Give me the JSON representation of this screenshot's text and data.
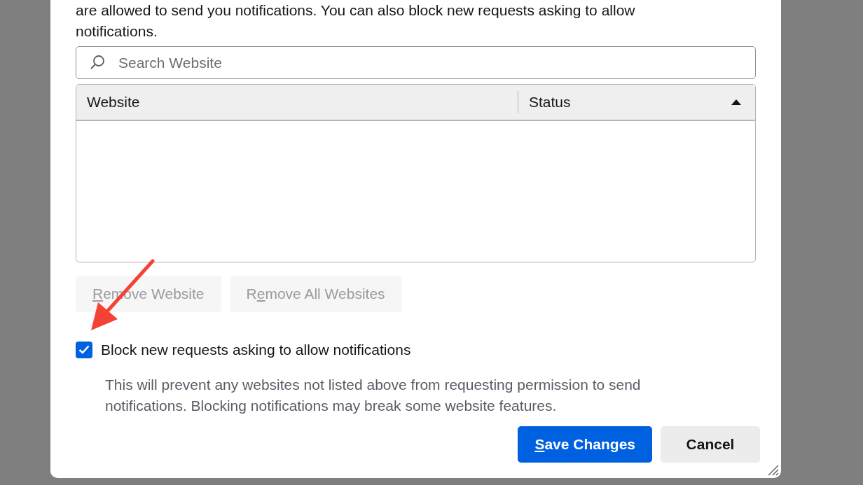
{
  "dialog": {
    "intro": "are allowed to send you notifications. You can also block new requests asking to allow notifications.",
    "search": {
      "placeholder": "Search Website"
    },
    "table": {
      "columns": [
        {
          "label": "Website",
          "sorted": false
        },
        {
          "label": "Status",
          "sorted": true
        }
      ]
    },
    "list_buttons": [
      {
        "access_key": "R",
        "after": "emove Website",
        "disabled": true
      },
      {
        "before": "R",
        "access_key": "e",
        "after": "move All Websites",
        "disabled": true
      }
    ],
    "block_checkbox": {
      "label": "Block new requests asking to allow notifications",
      "checked": true
    },
    "description": "This will prevent any websites not listed above from requesting permission to send notifications. Blocking notifications may break some website features.",
    "footer_buttons": [
      {
        "kind": "primary",
        "access_key": "S",
        "after": "ave Changes"
      },
      {
        "kind": "secondary",
        "before": "Cancel"
      }
    ]
  },
  "annotation": {
    "kind": "arrow"
  }
}
